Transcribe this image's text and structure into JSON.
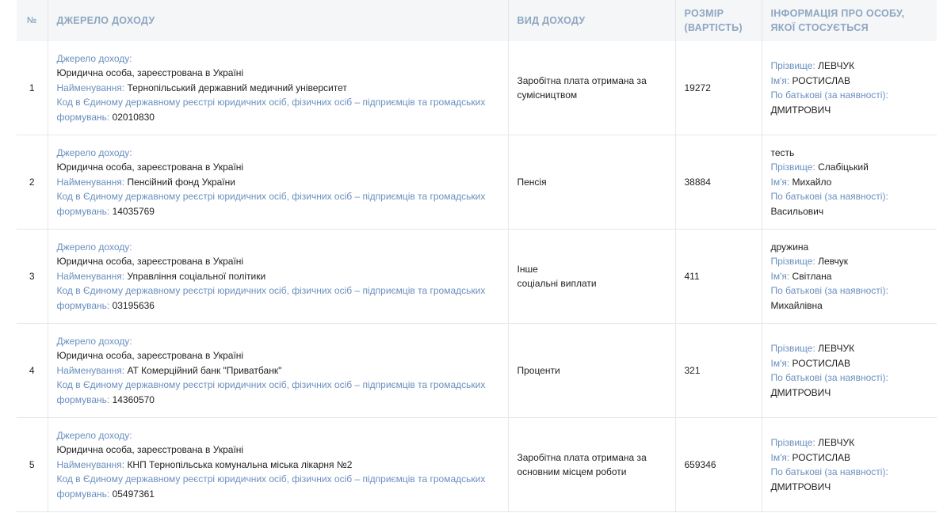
{
  "header": {
    "num": "№",
    "source": "ДЖЕРЕЛО ДОХОДУ",
    "type": "ВИД ДОХОДУ",
    "size_line1": "РОЗМІР",
    "size_line2": "(ВАРТІСТЬ)",
    "info_line1": "ІНФОРМАЦІЯ ПРО ОСОБУ,",
    "info_line2": "ЯКОЇ СТОСУЄТЬСЯ"
  },
  "labels": {
    "source_heading": "Джерело доходу:",
    "name": "Найменування: ",
    "code_line1": "Код в Єдиному державному реєстрі юридичних осіб, фізичних осіб – підприємців та громадських",
    "code_line2": "формувань: ",
    "surname": "Прізвище: ",
    "first_name": "Ім'я: ",
    "patronymic": "По батькові (за наявності):"
  },
  "rows": [
    {
      "num": "1",
      "source_kind": "Юридична особа, зареєстрована в Україні",
      "name": "Тернопільський державний медичний університет",
      "code": "02010830",
      "type_line1": "Заробітна плата отримана за",
      "type_line2": "сумісництвом",
      "amount": "19272",
      "relation": "",
      "surname": "ЛЕВЧУК",
      "first_name": "РОСТИСЛАВ",
      "patronymic": "ДМИТРОВИЧ"
    },
    {
      "num": "2",
      "source_kind": "Юридична особа, зареєстрована в Україні",
      "name": "Пенсійний фонд України",
      "code": "14035769",
      "type_line1": "Пенсія",
      "type_line2": "",
      "amount": "38884",
      "relation": "тесть",
      "surname": "Слабіцький",
      "first_name": "Михайло",
      "patronymic": "Васильович"
    },
    {
      "num": "3",
      "source_kind": "Юридична особа, зареєстрована в Україні",
      "name": "Управління соціальної політики",
      "code": "03195636",
      "type_line1": "Інше",
      "type_line2": "соціальні виплати",
      "amount": "411",
      "relation": "дружина",
      "surname": "Левчук",
      "first_name": "Світлана",
      "patronymic": "Михайлівна"
    },
    {
      "num": "4",
      "source_kind": "Юридична особа, зареєстрована в Україні",
      "name": "АТ Комерційний банк \"Приватбанк\"",
      "code": "14360570",
      "type_line1": "Проценти",
      "type_line2": "",
      "amount": "321",
      "relation": "",
      "surname": "ЛЕВЧУК",
      "first_name": "РОСТИСЛАВ",
      "patronymic": "ДМИТРОВИЧ"
    },
    {
      "num": "5",
      "source_kind": "Юридична особа, зареєстрована в Україні",
      "name": "КНП Тернопільська комунальна міська лікарня №2",
      "code": "05497361",
      "type_line1": "Заробітна плата отримана за",
      "type_line2": "основним місцем роботи",
      "amount": "659346",
      "relation": "",
      "surname": "ЛЕВЧУК",
      "first_name": "РОСТИСЛАВ",
      "patronymic": "ДМИТРОВИЧ"
    }
  ]
}
